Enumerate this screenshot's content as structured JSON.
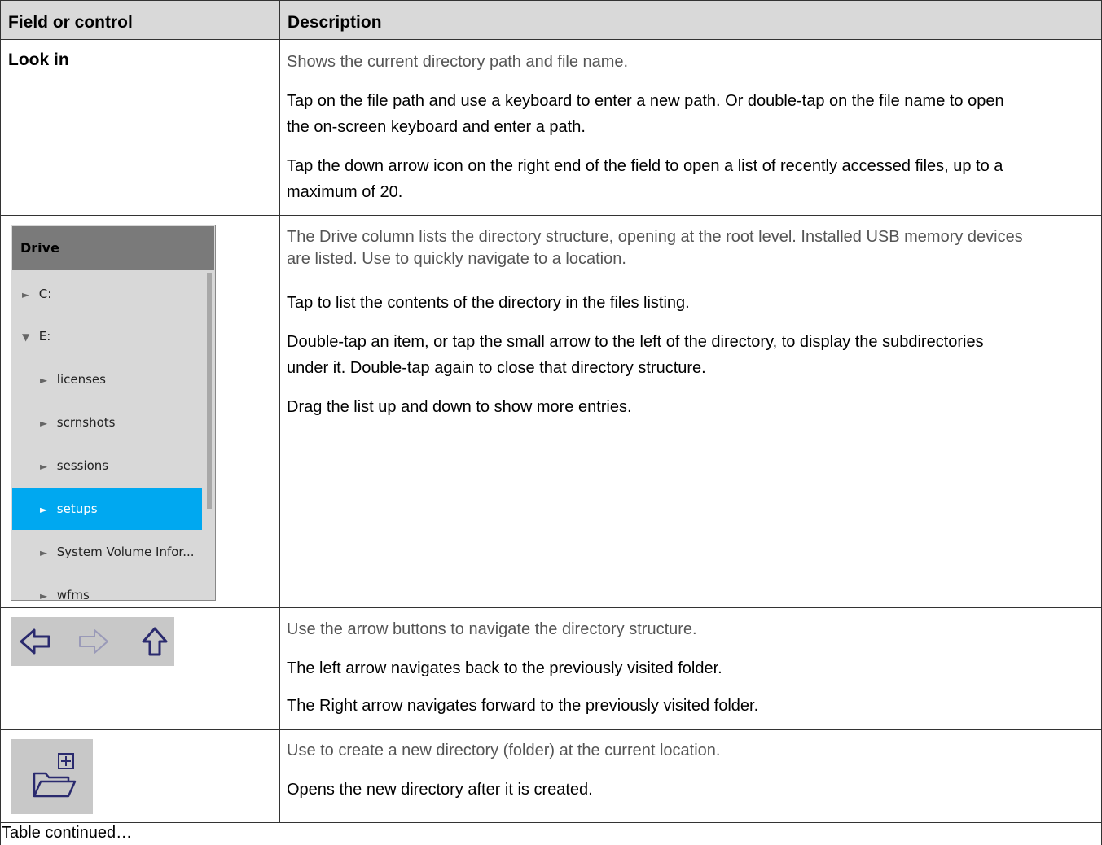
{
  "table": {
    "header": {
      "col1": "Field or control",
      "col2": "Description"
    },
    "rows": [
      {
        "label": "Look in",
        "paragraphs": [
          "Shows the current directory path and file name.",
          "Tap on the file path and use a keyboard to enter a new path. Or double-tap on the file name to open",
          "the on-screen keyboard and enter a path.",
          "Tap the down arrow icon on the right end of the field to open a list of recently accessed files, up to a",
          "maximum of 20."
        ]
      },
      {
        "paragraphs": [
          "The Drive column lists the directory structure, opening at the root level. Installed USB memory devices",
          "are listed. Use to quickly navigate to a location.",
          "Tap to list the contents of the directory in the files listing.",
          "Double-tap an item, or tap the small arrow to the left of the directory, to display the subdirectories",
          "under it. Double-tap again to close that directory structure.",
          "Drag the list up and down to show more entries."
        ]
      },
      {
        "paragraphs": [
          "Use the arrow buttons to navigate the directory structure.",
          "The left arrow navigates back to the previously visited folder.",
          "The Right arrow navigates forward to the previously visited folder."
        ]
      },
      {
        "paragraphs": [
          "Use to create a new directory (folder) at the current location.",
          "Opens the new directory after it is created."
        ]
      }
    ],
    "footer": "Table continued…"
  },
  "drive_panel": {
    "title": "Drive",
    "items": [
      {
        "label": "C:",
        "arrow": "►"
      },
      {
        "label": "E:",
        "arrow": "▼"
      },
      {
        "label": "licenses",
        "arrow": "►"
      },
      {
        "label": "scrnshots",
        "arrow": "►"
      },
      {
        "label": "sessions",
        "arrow": "►"
      },
      {
        "label": "setups",
        "arrow": "►",
        "selected": true
      },
      {
        "label": "System Volume Infor...",
        "arrow": "►"
      },
      {
        "label": "wfms",
        "arrow": "►"
      }
    ]
  },
  "icons": {
    "back": "left-arrow-icon",
    "forward": "right-arrow-icon",
    "up": "up-arrow-icon",
    "new_folder": "new-folder-icon"
  },
  "colors": {
    "header_bg": "#d9d9d9",
    "selected": "#00a8f0",
    "icon_navy": "#2a2a6e"
  }
}
